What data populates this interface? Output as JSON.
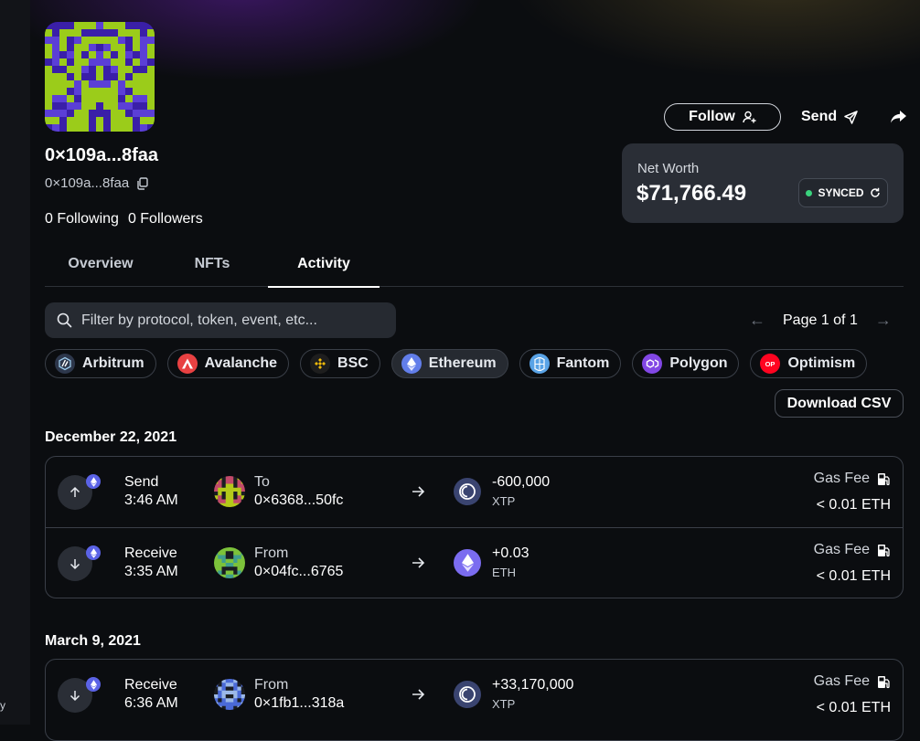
{
  "sidebar": {
    "edge_text": "y"
  },
  "profile": {
    "handle": "0×109a...8faa",
    "address": "0×109a...8faa",
    "following_text": "0 Following",
    "followers_text": "0 Followers"
  },
  "actions": {
    "follow_label": "Follow",
    "send_label": "Send"
  },
  "networth": {
    "label": "Net Worth",
    "value": "$71,766.49",
    "status": "SYNCED"
  },
  "tabs": [
    {
      "label": "Overview",
      "active": false
    },
    {
      "label": "NFTs",
      "active": false
    },
    {
      "label": "Activity",
      "active": true
    }
  ],
  "search": {
    "placeholder": "Filter by protocol, token, event, etc..."
  },
  "pagination": {
    "text": "Page 1 of 1"
  },
  "chains": [
    {
      "label": "Arbitrum",
      "icon": "arbitrum-icon",
      "color": "#2d374b",
      "selected": false
    },
    {
      "label": "Avalanche",
      "icon": "avalanche-icon",
      "color": "#e84142",
      "selected": false
    },
    {
      "label": "BSC",
      "icon": "bsc-icon",
      "color": "#f0b90b",
      "selected": false
    },
    {
      "label": "Ethereum",
      "icon": "ethereum-icon",
      "color": "#627eea",
      "selected": true
    },
    {
      "label": "Fantom",
      "icon": "fantom-icon",
      "color": "#1969ff",
      "selected": false
    },
    {
      "label": "Polygon",
      "icon": "polygon-icon",
      "color": "#8247e5",
      "selected": false
    },
    {
      "label": "Optimism",
      "icon": "optimism-icon",
      "color": "#ff0420",
      "selected": false
    }
  ],
  "download_label": "Download CSV",
  "activity": {
    "gas_label": "Gas Fee",
    "groups": [
      {
        "date": "December 22, 2021",
        "rows": [
          {
            "type": "Send",
            "time": "3:46 AM",
            "direction": "out",
            "cp_label": "To",
            "cp_address": "0×6368...50fc",
            "amount": "-600,000",
            "symbol": "XTP",
            "gas": "< 0.01 ETH"
          },
          {
            "type": "Receive",
            "time": "3:35 AM",
            "direction": "in",
            "cp_label": "From",
            "cp_address": "0×04fc...6765",
            "amount": "+0.03",
            "symbol": "ETH",
            "gas": "< 0.01 ETH"
          }
        ]
      },
      {
        "date": "March 9, 2021",
        "rows": [
          {
            "type": "Receive",
            "time": "6:36 AM",
            "direction": "in",
            "cp_label": "From",
            "cp_address": "0×1fb1...318a",
            "amount": "+33,170,000",
            "symbol": "XTP",
            "gas": "< 0.01 ETH"
          }
        ]
      }
    ]
  },
  "colors": {
    "accent_purple": "#5b3fd6",
    "accent_lime": "#9bcc1a",
    "synced_dot": "#3ad37d"
  }
}
